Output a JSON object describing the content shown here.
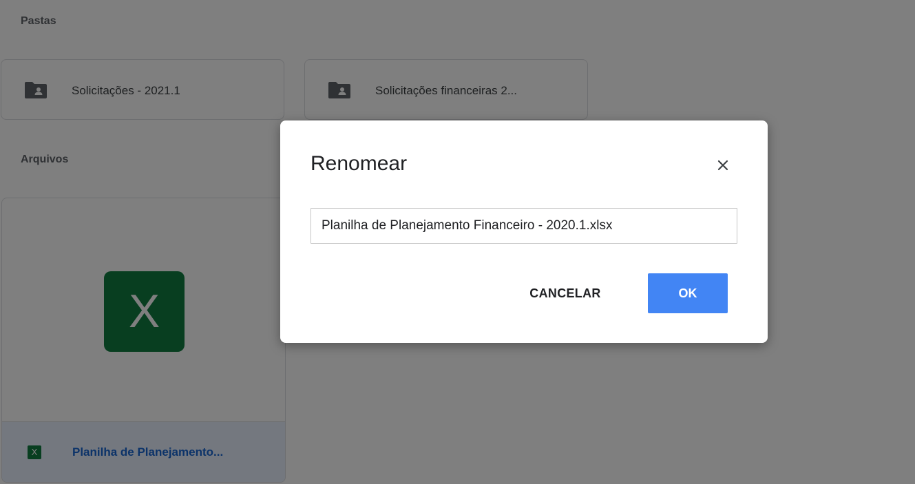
{
  "sections": {
    "folders_label": "Pastas",
    "files_label": "Arquivos"
  },
  "folders": [
    {
      "name": "Solicitações - 2021.1",
      "icon": "shared-folder-icon"
    },
    {
      "name": "Solicitações financeiras 2...",
      "icon": "shared-folder-icon"
    }
  ],
  "files": [
    {
      "name": "Planilha de Planejamento...",
      "icon": "excel-icon",
      "thumb_letter": "X",
      "icon_letter": "X"
    }
  ],
  "dialog": {
    "title": "Renomear",
    "close_icon": "close-icon",
    "input_value": "Planilha de Planejamento Financeiro - 2020.1.xlsx",
    "cancel_label": "CANCELAR",
    "ok_label": "OK"
  },
  "colors": {
    "excel_green": "#107c41",
    "ok_button": "#4285f4",
    "selected_file_bg": "#e8f0fe",
    "selected_file_text": "#1967d2"
  }
}
